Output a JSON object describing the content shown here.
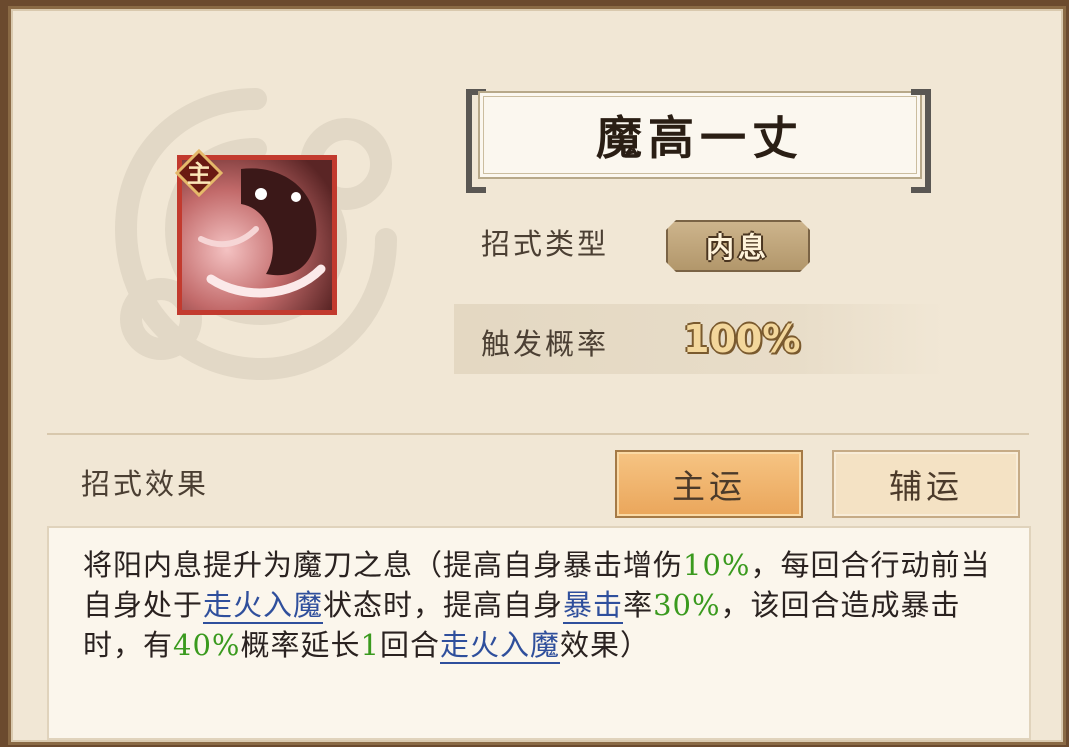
{
  "title": "魔高一丈",
  "icon_badge": "主",
  "type_label": "招式类型",
  "type_value": "内息",
  "rate_label": "触发概率",
  "rate_value": "100%",
  "effect_label": "招式效果",
  "buttons": {
    "main": "主运",
    "assist": "辅运"
  },
  "description": {
    "p1": "将阳内息提升为魔刀之息（提高自身暴击增伤",
    "v1": "10%",
    "p2": "，每回合行动前当自身处于",
    "link1": "走火入魔",
    "p3": "状态时，提高自身",
    "link2": "暴击",
    "p4": "率",
    "v2": "30%",
    "p5": "，该回合造成暴击时，有",
    "v3": "40%",
    "p6": "概率延长",
    "v4": "1",
    "p7": "回合",
    "link3": "走火入魔",
    "p8": "效果）"
  },
  "colors": {
    "accent_green": "#3a9a1e",
    "link_blue": "#2f4f9c",
    "button_active": "#eaa65b"
  }
}
